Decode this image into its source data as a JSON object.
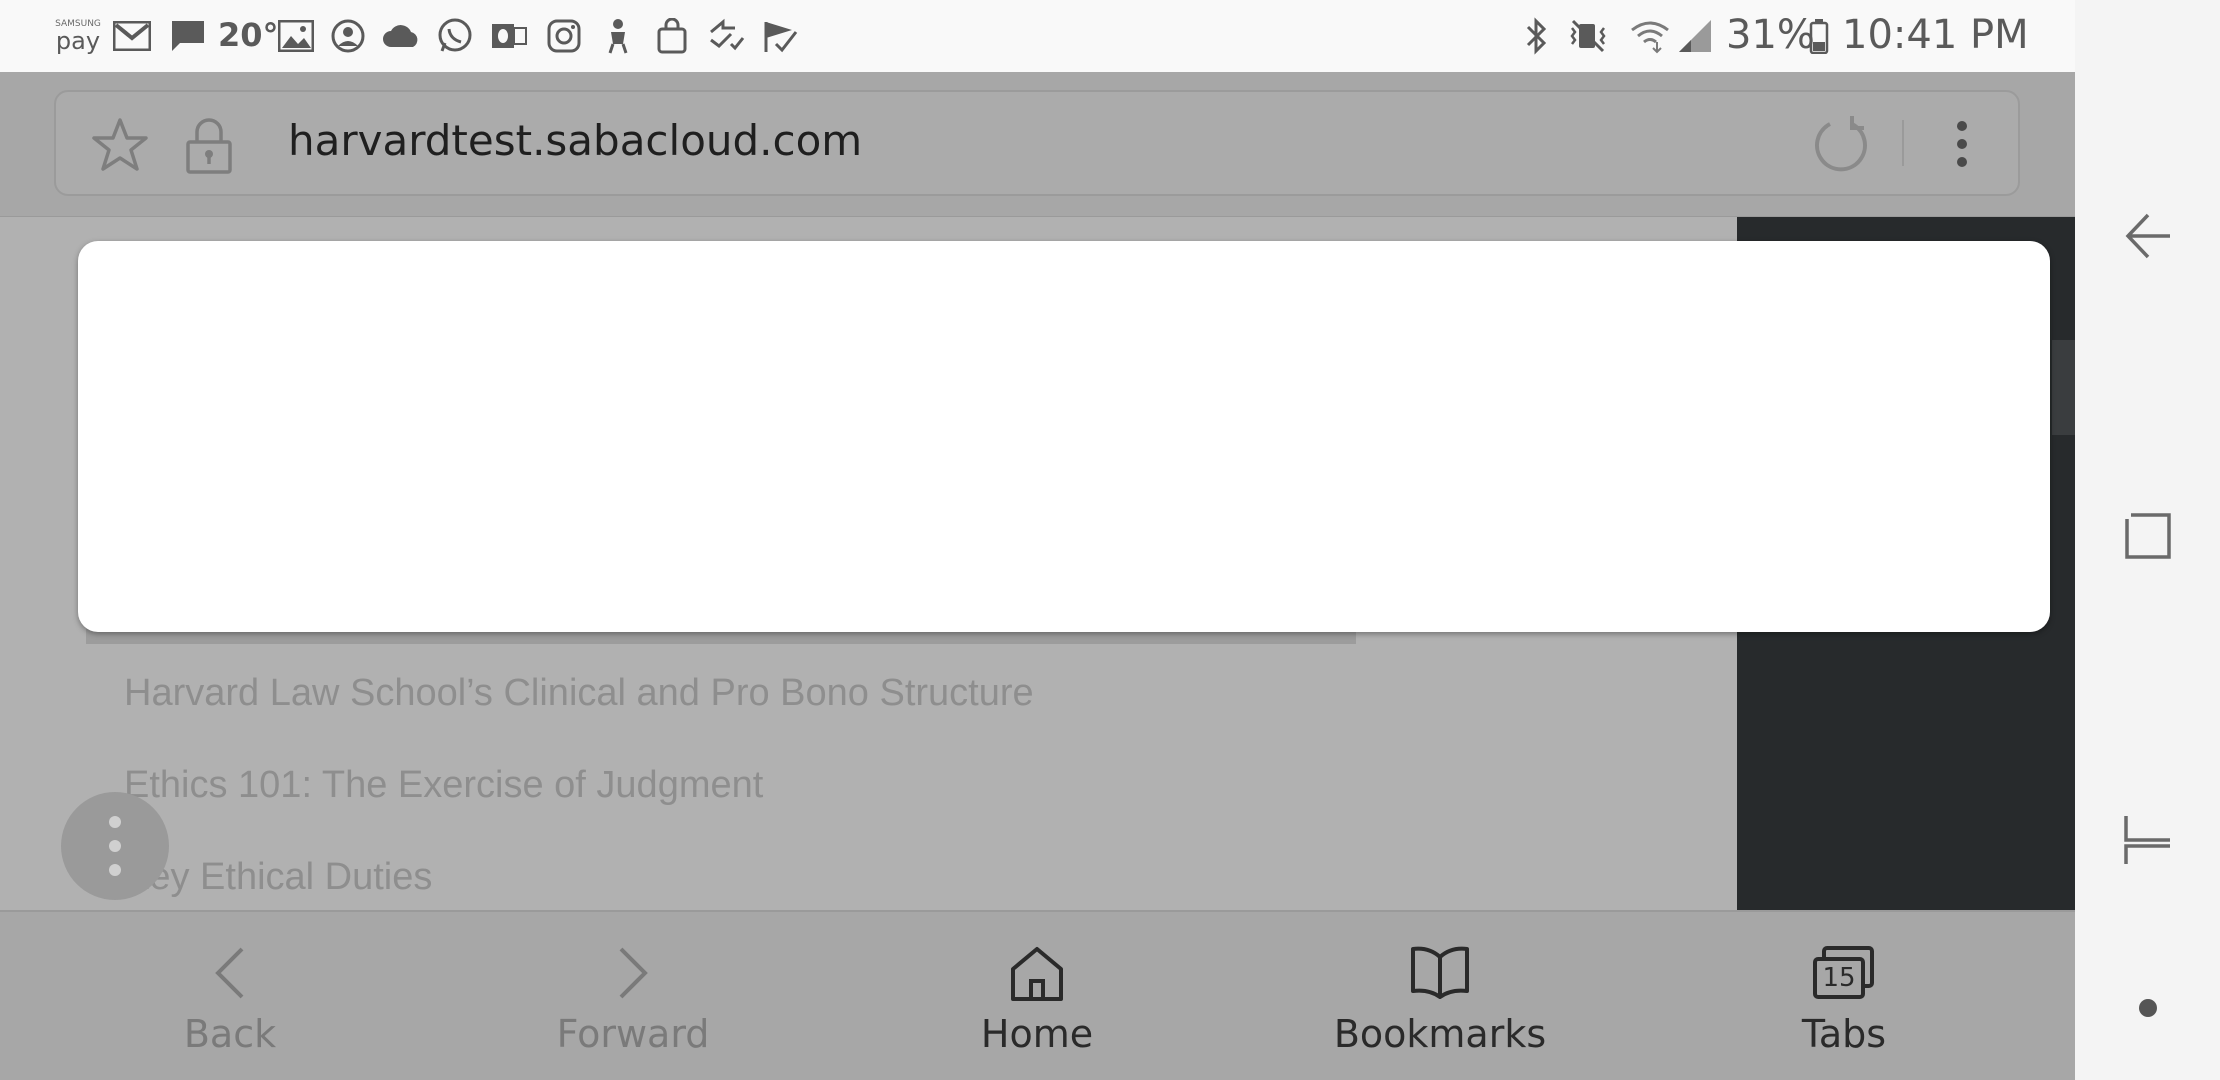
{
  "status_bar": {
    "pay_top": "SAMSUNG",
    "pay_bottom": "pay",
    "temperature": "20°",
    "battery": "31%",
    "time": "10:41 PM"
  },
  "browser": {
    "url": "harvardtest.sabacloud.com"
  },
  "page": {
    "links": [
      "Harvard Law School’s Clinical and Pro Bono Structure",
      "Ethics 101: The Exercise of Judgment",
      "Key Ethical Duties"
    ]
  },
  "bottom_nav": {
    "back": "Back",
    "forward": "Forward",
    "home": "Home",
    "bookmarks": "Bookmarks",
    "tabs": "Tabs",
    "tab_count": "15"
  },
  "colors": {
    "overlay_gray": "#acacac",
    "dark_panel": "#272a2c",
    "modal": "#ffffff"
  }
}
